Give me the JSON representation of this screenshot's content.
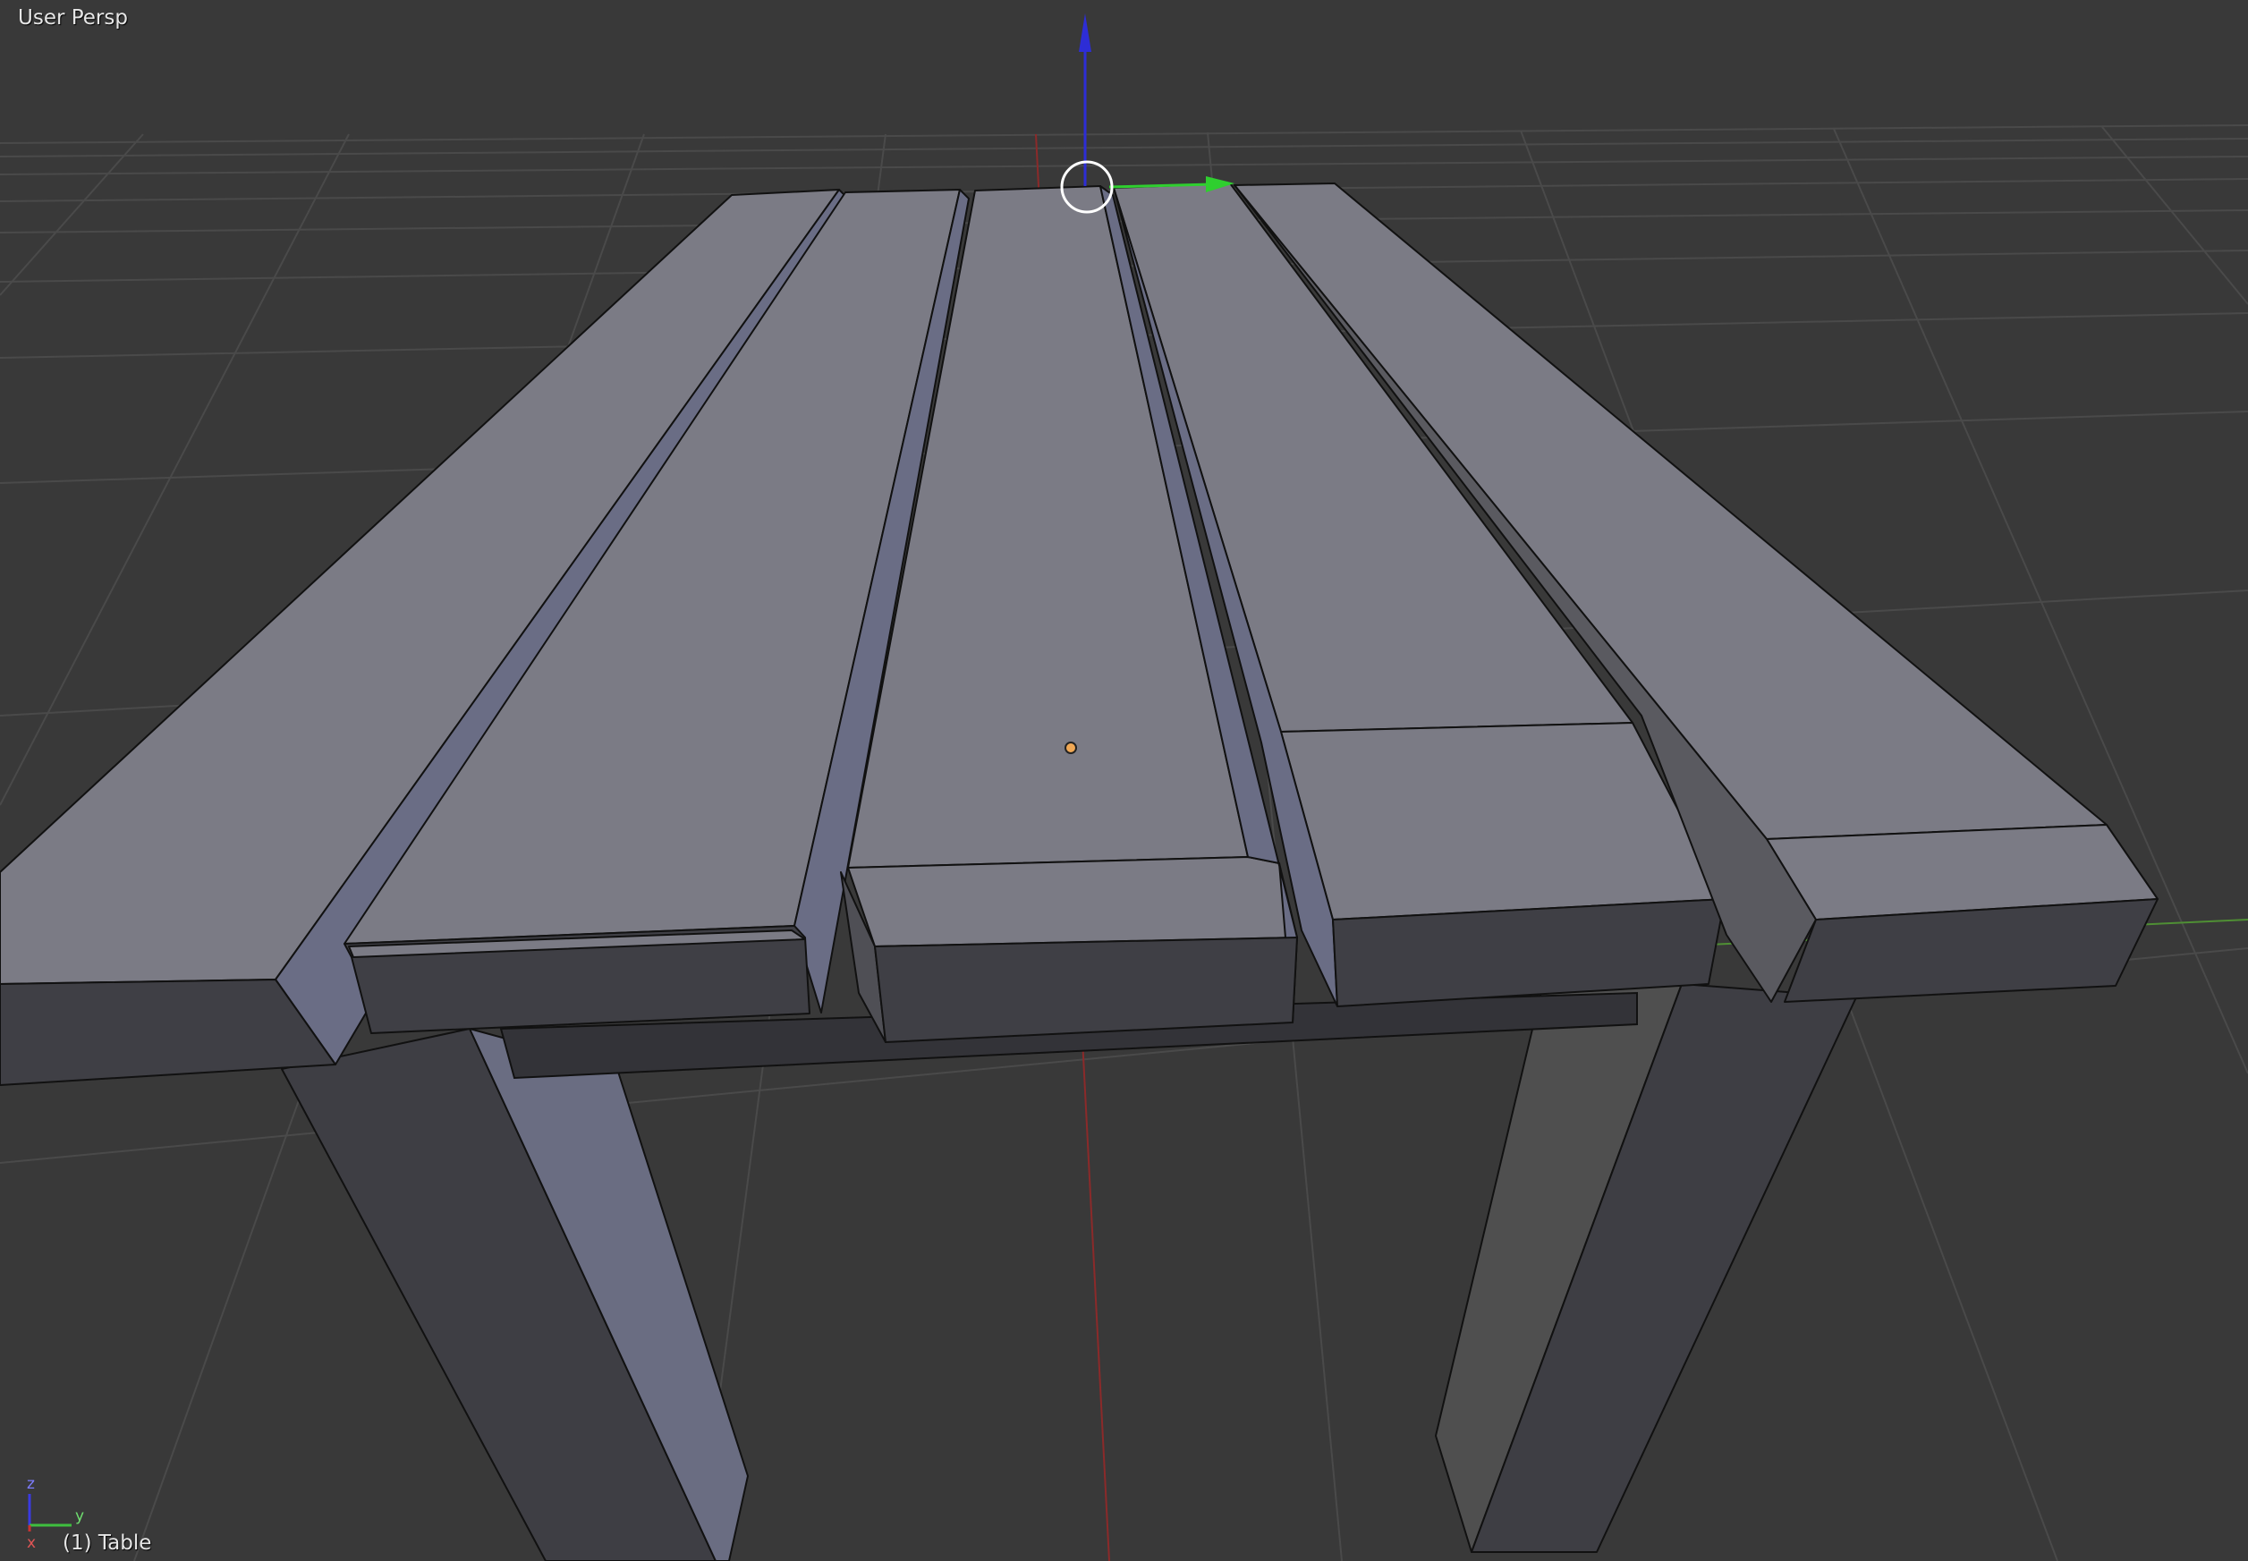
{
  "viewport": {
    "view_name": "User Persp",
    "object_info": "(1) Table"
  },
  "mini_axes": {
    "z_label": "z",
    "y_label": "y",
    "x_label": "x"
  },
  "colors": {
    "background": "#393939",
    "grid_line": "#4a4a4a",
    "x_axis": "#8b2a2a",
    "y_axis": "#4f8f34",
    "z_axis": "#2d2dd6",
    "plank_top": "#7b7b85",
    "plank_side": "#3f3f45",
    "plank_bevel": "#6a6d85",
    "leg_light": "#6a6d82",
    "leg_dark": "#3e3e44",
    "origin_dot": "#f0a855"
  }
}
